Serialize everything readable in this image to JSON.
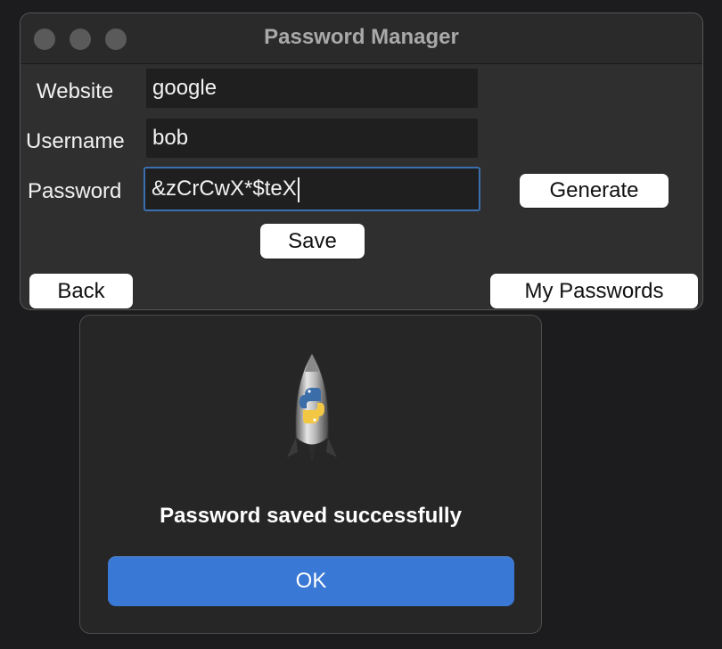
{
  "window": {
    "title": "Password Manager"
  },
  "form": {
    "website_label": "Website",
    "website_value": "google",
    "username_label": "Username",
    "username_value": "bob",
    "password_label": "Password",
    "password_value": "&zCrCwX*$teX"
  },
  "buttons": {
    "generate": "Generate",
    "save": "Save",
    "back": "Back",
    "my_passwords": "My Passwords"
  },
  "dialog": {
    "message": "Password saved successfully",
    "ok": "OK",
    "icon": "python-rocket-icon"
  },
  "colors": {
    "accent": "#3a78d6",
    "focus_ring": "#3c6fb0"
  }
}
